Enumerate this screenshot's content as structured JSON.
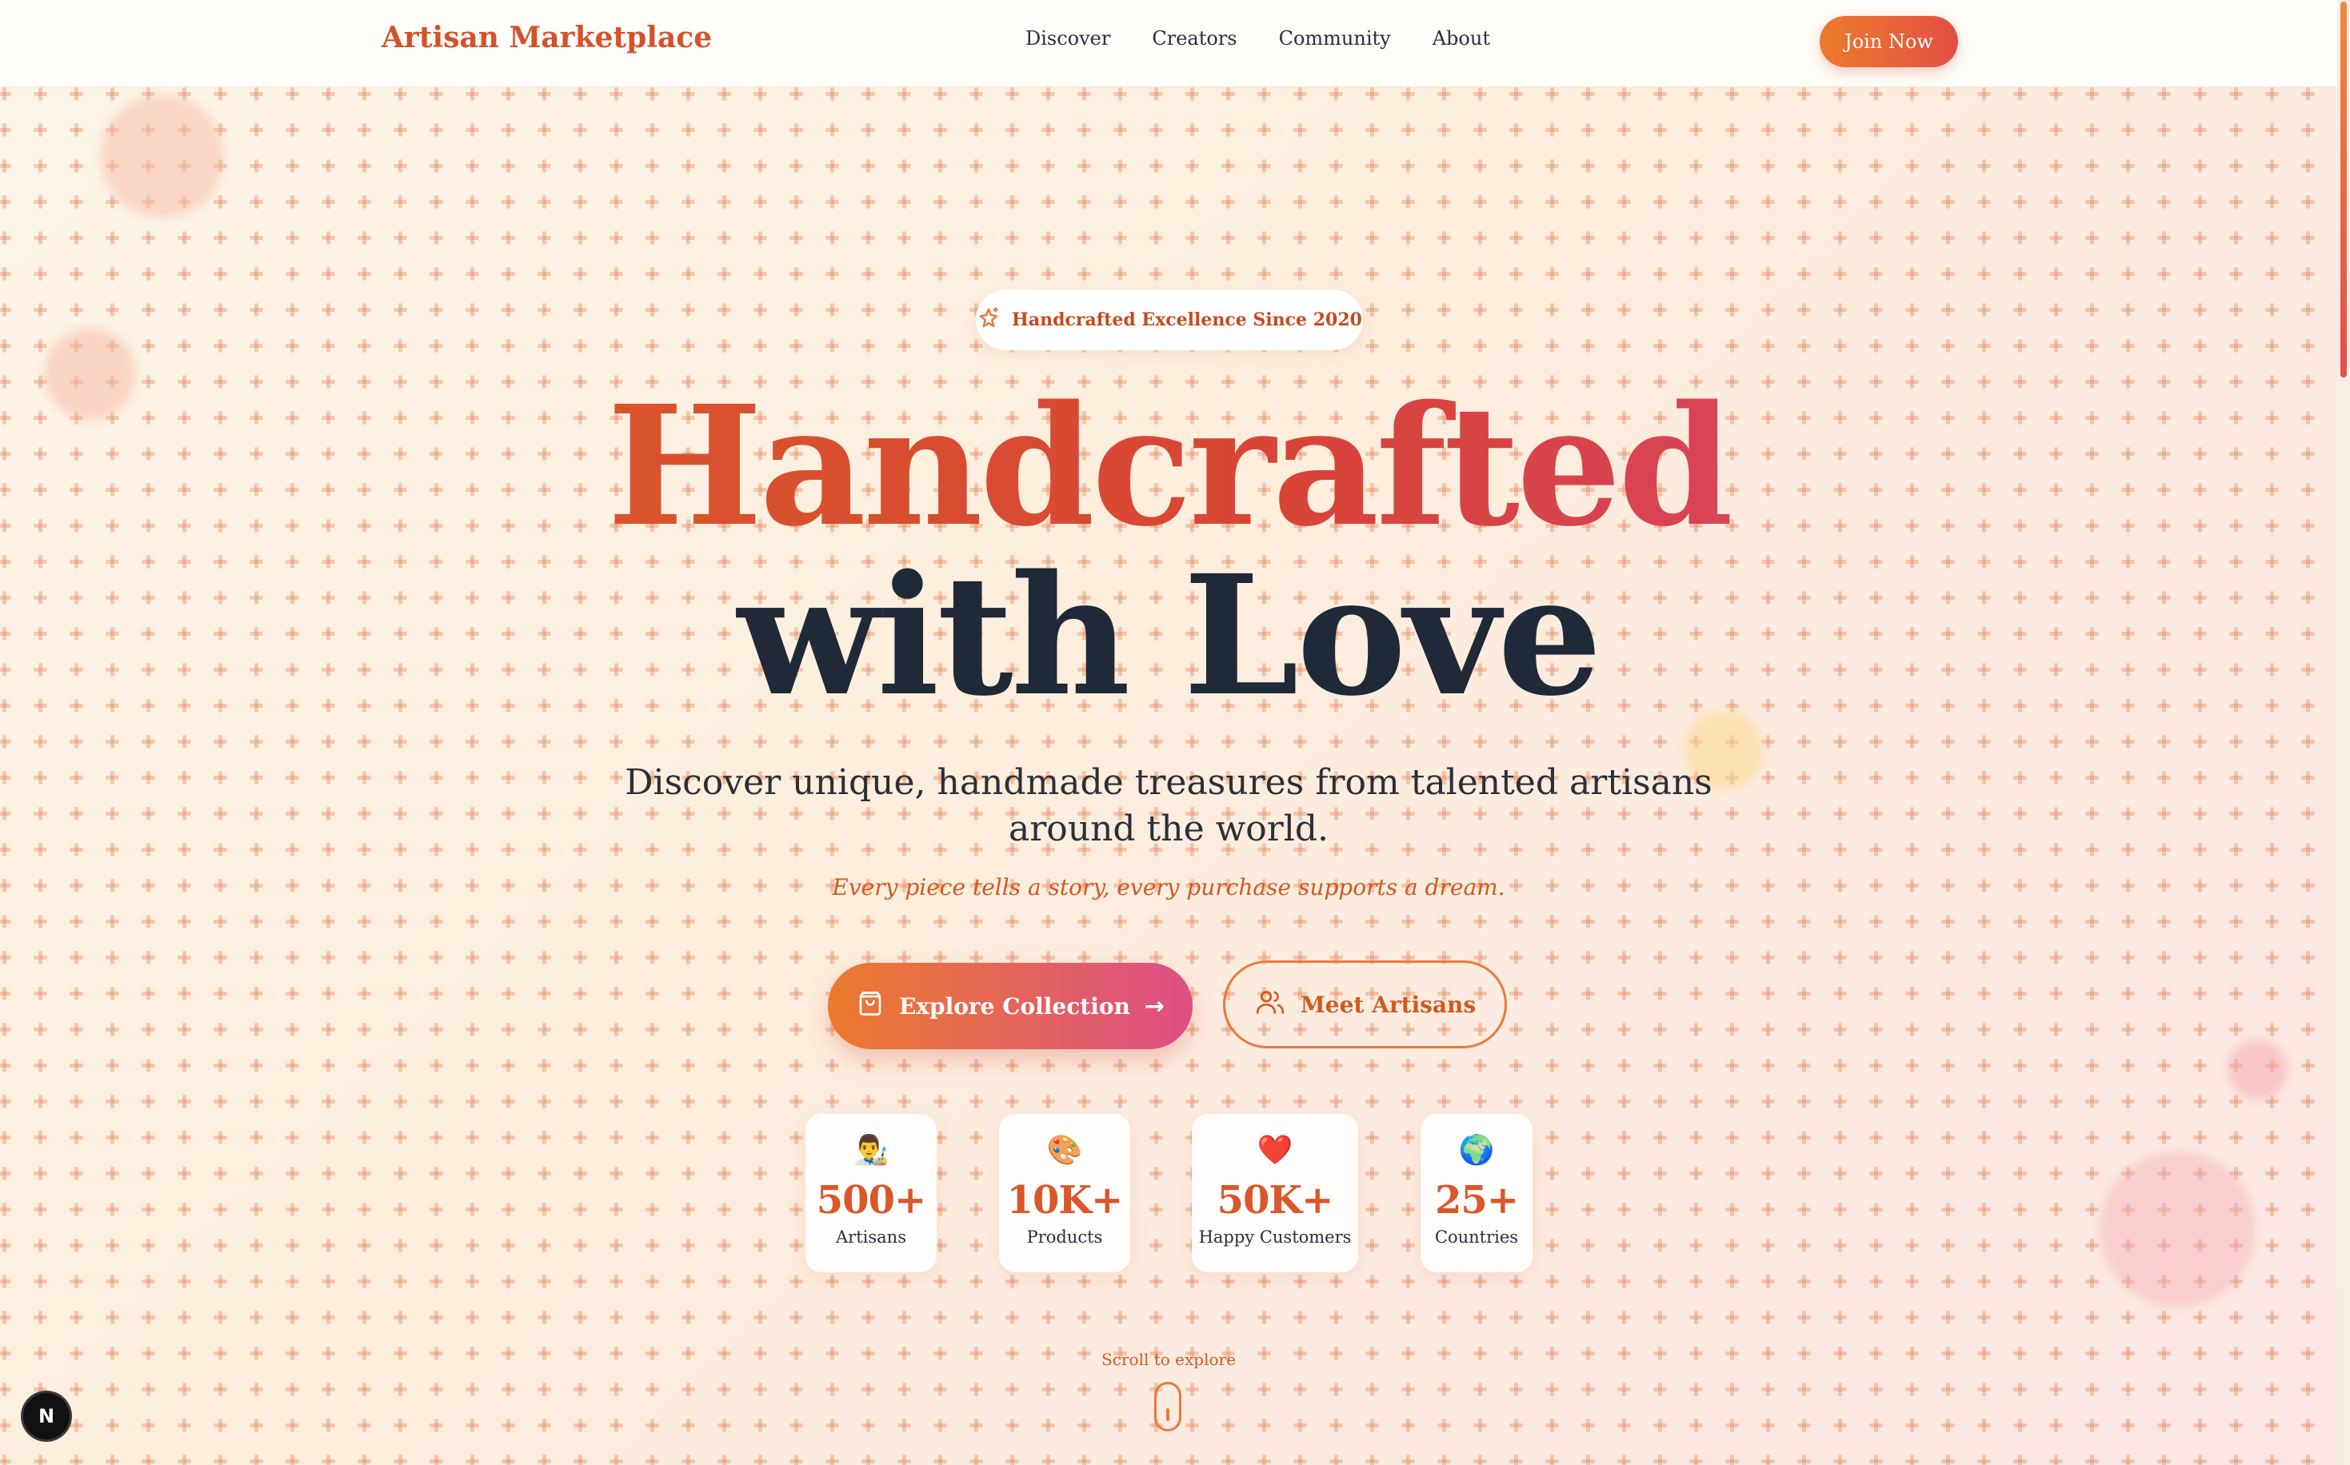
{
  "header": {
    "brand": "Artisan Marketplace",
    "nav": [
      "Discover",
      "Creators",
      "Community",
      "About"
    ],
    "cta": "Join Now"
  },
  "hero": {
    "badge": "Handcrafted Excellence Since 2020",
    "title_line1": "Handcrafted",
    "title_line2": "with Love",
    "subtitle": "Discover unique, handmade treasures from talented artisans around the world.",
    "tagline": "Every piece tells a story, every purchase supports a dream.",
    "primary_button": "Explore Collection",
    "primary_arrow": "→",
    "secondary_button": "Meet Artisans"
  },
  "stats": [
    {
      "emoji": "👨‍🎨",
      "value": "500+",
      "label": "Artisans"
    },
    {
      "emoji": "🎨",
      "value": "10K+",
      "label": "Products"
    },
    {
      "emoji": "❤️",
      "value": "50K+",
      "label": "Happy Customers"
    },
    {
      "emoji": "🌍",
      "value": "25+",
      "label": "Countries"
    }
  ],
  "scroll_hint": "Scroll to explore",
  "dev_badge": "N",
  "colors": {
    "accent": "#d9572a",
    "accent_gradient_start": "#ec7a2c",
    "accent_gradient_end": "#dc4f86",
    "heading_dark": "#1f2937"
  },
  "icons": {
    "badge": "sparkles-icon",
    "primary_button": "shopping-bag-icon",
    "secondary_button": "users-icon",
    "scroll": "mouse-icon"
  }
}
